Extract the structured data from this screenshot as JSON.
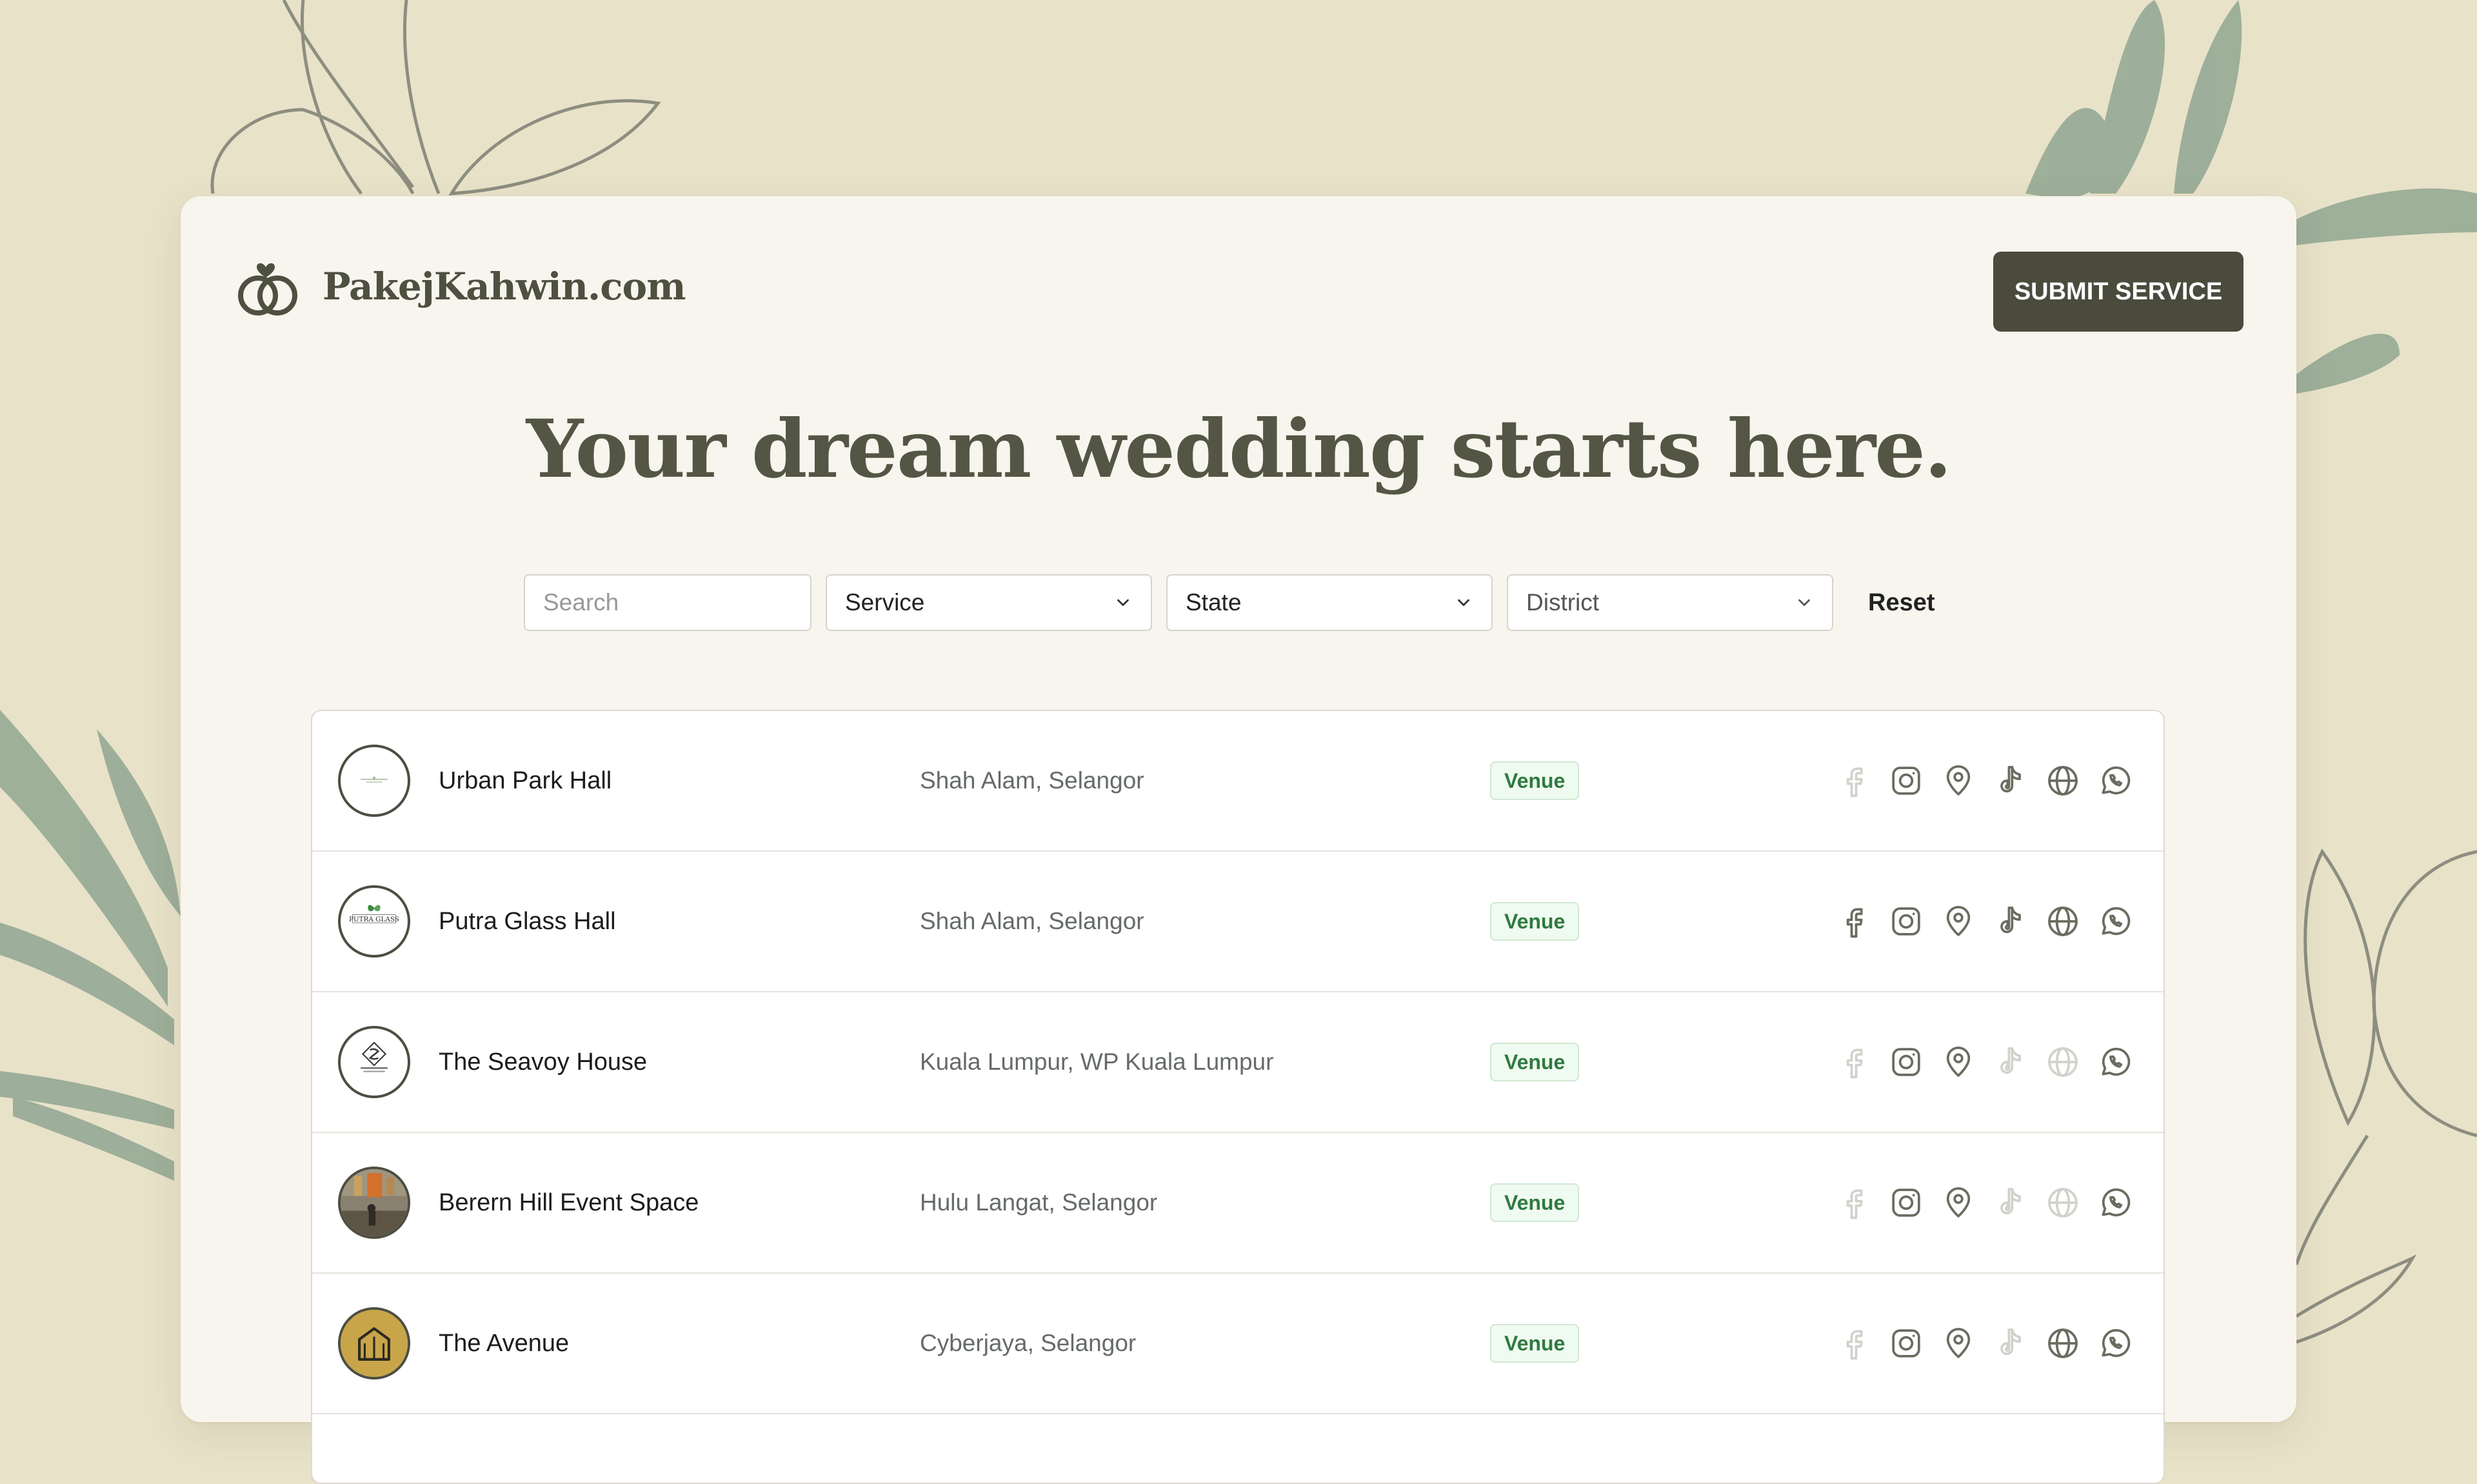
{
  "brand": {
    "name": "PakejKahwin.com"
  },
  "header": {
    "submit_label": "SUBMIT SERVICE"
  },
  "hero": {
    "title": "Your dream wedding starts here."
  },
  "filters": {
    "search_placeholder": "Search",
    "service_label": "Service",
    "state_label": "State",
    "district_label": "District",
    "reset_label": "Reset"
  },
  "colors": {
    "background": "#e8e2c9",
    "card": "#f7f5ee",
    "primary_button": "#4a4b3d",
    "heading": "#545645",
    "badge_text": "#2f7a3f",
    "badge_bg": "#effaf0",
    "leaf": "#9aac98"
  },
  "listings": [
    {
      "name": "Urban Park Hall",
      "location": "Shah Alam, Selangor",
      "category": "Venue",
      "logo_icon": "urban-park-logo",
      "socials": {
        "facebook": false,
        "instagram": true,
        "map": true,
        "tiktok": true,
        "website": true,
        "whatsapp": true
      }
    },
    {
      "name": "Putra Glass Hall",
      "location": "Shah Alam, Selangor",
      "category": "Venue",
      "logo_icon": "putra-glass-logo",
      "socials": {
        "facebook": true,
        "instagram": true,
        "map": true,
        "tiktok": true,
        "website": true,
        "whatsapp": true
      }
    },
    {
      "name": "The Seavoy House",
      "location": "Kuala Lumpur, WP Kuala Lumpur",
      "category": "Venue",
      "logo_icon": "seavoy-house-logo",
      "socials": {
        "facebook": false,
        "instagram": true,
        "map": true,
        "tiktok": false,
        "website": false,
        "whatsapp": true
      }
    },
    {
      "name": "Berern Hill Event Space",
      "location": "Hulu Langat, Selangor",
      "category": "Venue",
      "logo_icon": "berern-hill-photo",
      "socials": {
        "facebook": false,
        "instagram": true,
        "map": true,
        "tiktok": false,
        "website": false,
        "whatsapp": true
      }
    },
    {
      "name": "The Avenue",
      "location": "Cyberjaya, Selangor",
      "category": "Venue",
      "logo_icon": "the-avenue-logo",
      "socials": {
        "facebook": false,
        "instagram": true,
        "map": true,
        "tiktok": false,
        "website": true,
        "whatsapp": true
      }
    }
  ]
}
